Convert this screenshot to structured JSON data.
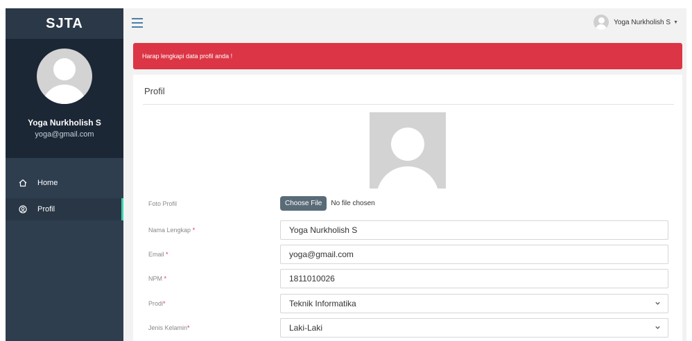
{
  "app": {
    "brand": "SJTA"
  },
  "sidebar": {
    "user": {
      "name": "Yoga Nurkholish S",
      "email": "yoga@gmail.com"
    },
    "items": [
      {
        "label": "Home",
        "icon": "home-icon",
        "active": false
      },
      {
        "label": "Profil",
        "icon": "user-circle-icon",
        "active": true
      }
    ]
  },
  "topbar": {
    "username": "Yoga Nurkholish S",
    "caret": "▼"
  },
  "alert": {
    "text": "Harap lengkapi data profil anda !",
    "color": "#dc3545"
  },
  "profile": {
    "title": "Profil",
    "photo_label": "Foto Profil",
    "file_button": "Choose File",
    "file_status": "No file chosen",
    "fields": [
      {
        "label": "Nama Lengkap",
        "required": "*",
        "value": "Yoga Nurkholish S"
      },
      {
        "label": "Email",
        "required": "*",
        "value": "yoga@gmail.com"
      },
      {
        "label": "NPM",
        "required": "*",
        "value": "1811010026"
      },
      {
        "label": "Prodi",
        "required": "*",
        "value": "Teknik Informatika"
      },
      {
        "label": "Jenis Kelamin",
        "required": "*",
        "value": "Laki-Laki"
      }
    ]
  },
  "colors": {
    "sidebar": "#2f3e4f",
    "sidebar_dark": "#1b2735",
    "accent": "#3fd3b0",
    "danger": "#dc3545"
  }
}
